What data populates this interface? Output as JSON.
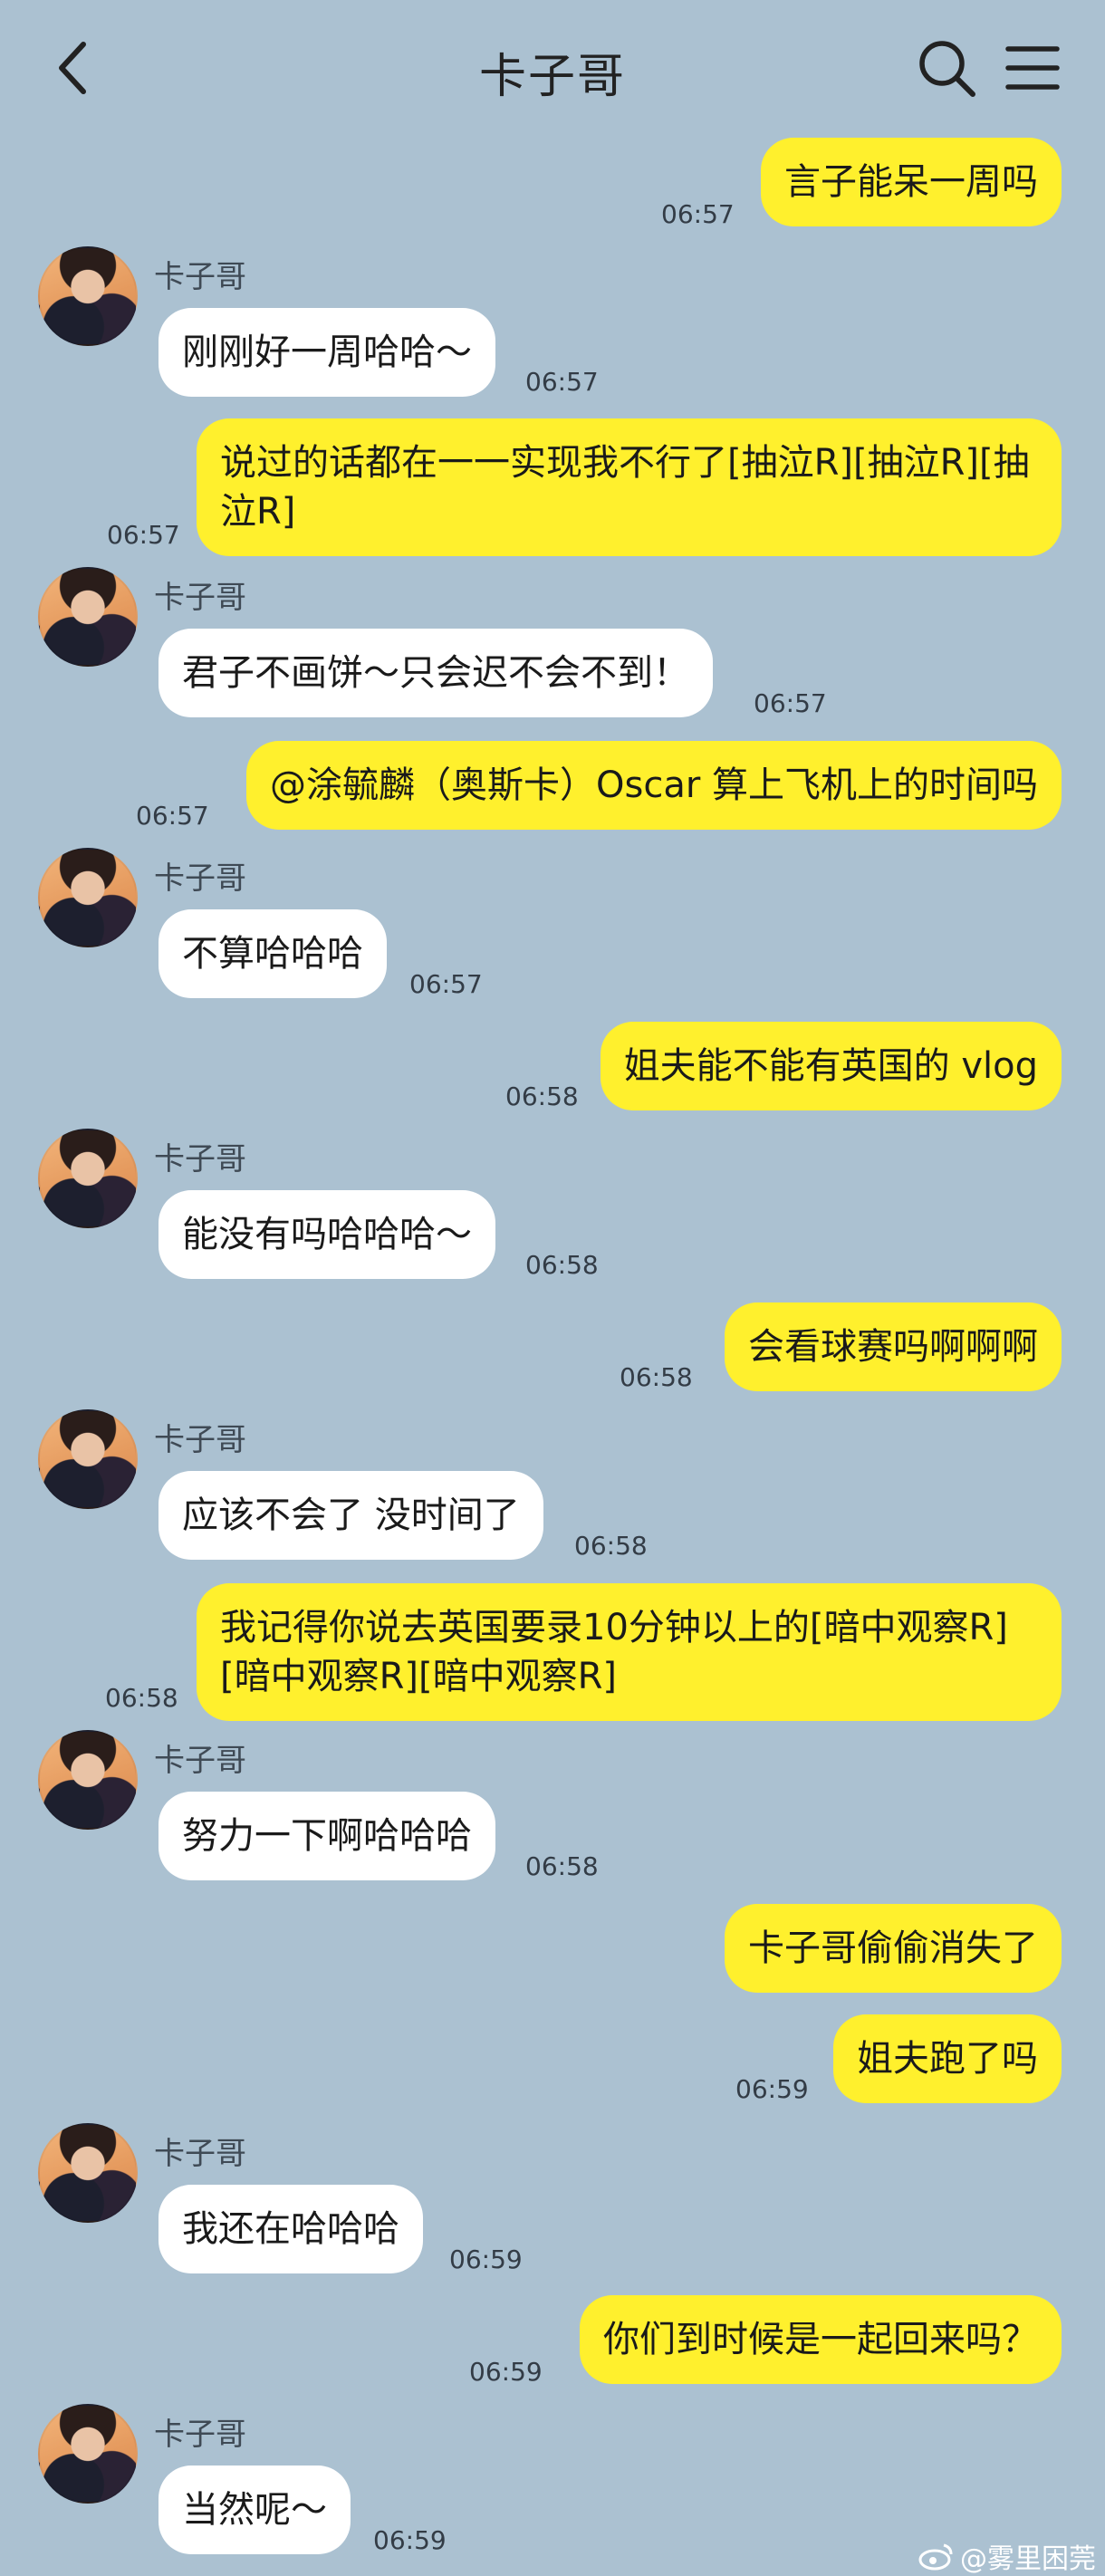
{
  "header": {
    "title": "卡子哥"
  },
  "contact": {
    "name": "卡子哥"
  },
  "messages": [
    {
      "dir": "out",
      "text": "言子能呆一周吗",
      "time": "06:57"
    },
    {
      "dir": "in",
      "text": "刚刚好一周哈哈～",
      "time": "06:57"
    },
    {
      "dir": "out",
      "text": "说过的话都在一一实现我不行了[抽泣R][抽泣R][抽泣R]",
      "time": "06:57"
    },
    {
      "dir": "in",
      "text": "君子不画饼～只会迟不会不到！",
      "time": "06:57"
    },
    {
      "dir": "out",
      "text": "@涂毓麟（奥斯卡）Oscar 算上飞机上的时间吗",
      "time": "06:57"
    },
    {
      "dir": "in",
      "text": "不算哈哈哈",
      "time": "06:57"
    },
    {
      "dir": "out",
      "text": "姐夫能不能有英国的 vlog",
      "time": "06:58"
    },
    {
      "dir": "in",
      "text": "能没有吗哈哈哈～",
      "time": "06:58"
    },
    {
      "dir": "out",
      "text": "会看球赛吗啊啊啊",
      "time": "06:58"
    },
    {
      "dir": "in",
      "text": "应该不会了 没时间了",
      "time": "06:58"
    },
    {
      "dir": "out",
      "text": "我记得你说去英国要录10分钟以上的[暗中观察R][暗中观察R][暗中观察R]",
      "time": "06:58"
    },
    {
      "dir": "in",
      "text": "努力一下啊哈哈哈",
      "time": "06:58"
    },
    {
      "dir": "out",
      "text": "卡子哥偷偷消失了",
      "time": ""
    },
    {
      "dir": "out",
      "text": "姐夫跑了吗",
      "time": "06:59"
    },
    {
      "dir": "in",
      "text": "我还在哈哈哈",
      "time": "06:59"
    },
    {
      "dir": "out",
      "text": "你们到时候是一起回来吗？",
      "time": "06:59"
    },
    {
      "dir": "in",
      "text": "当然呢～",
      "time": "06:59"
    }
  ],
  "watermark": "@雾里困莞"
}
